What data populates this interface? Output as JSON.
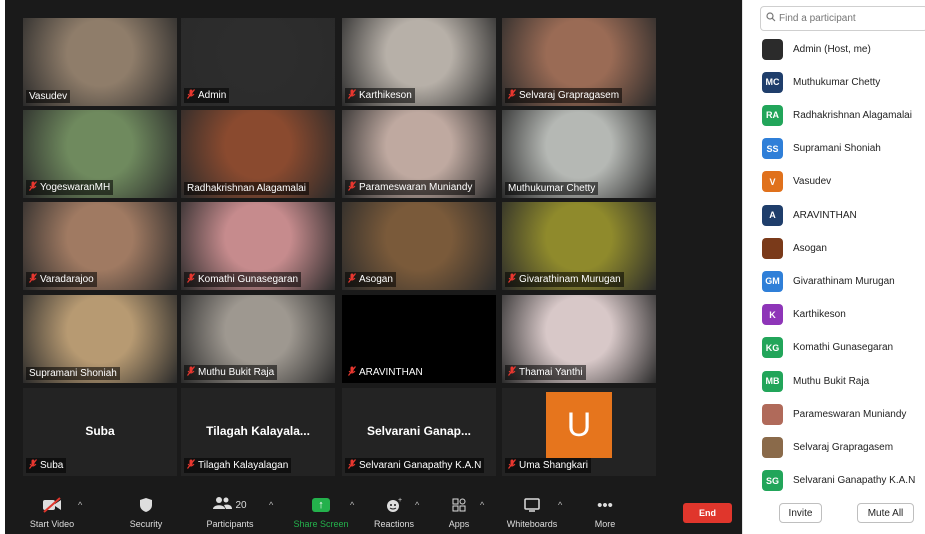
{
  "tiles": [
    {
      "name": "Vasudev",
      "muted": false,
      "video": true,
      "bg": "#8f7d6a"
    },
    {
      "name": "Admin",
      "muted": true,
      "video": true,
      "bg": "#2d2d2d"
    },
    {
      "name": "Karthikeson",
      "muted": true,
      "video": true,
      "bg": "#b7b0a8"
    },
    {
      "name": "Selvaraj Grapragasem",
      "muted": true,
      "video": true,
      "bg": "#9a6b55"
    },
    {
      "name": "YogeswaranMH",
      "muted": true,
      "video": true,
      "bg": "#6f8a5e"
    },
    {
      "name": "Radhakrishnan Alagamalai",
      "muted": false,
      "video": true,
      "bg": "#8a4a2f",
      "speaking": true
    },
    {
      "name": "Parameswaran Muniandy",
      "muted": true,
      "video": true,
      "bg": "#bfa9a0"
    },
    {
      "name": "Muthukumar Chetty",
      "muted": false,
      "video": true,
      "bg": "#b5b8b4"
    },
    {
      "name": "Varadarajoo",
      "muted": true,
      "video": true,
      "bg": "#a07a62"
    },
    {
      "name": "Komathi Gunasegaran",
      "muted": true,
      "video": true,
      "bg": "#c68b8d"
    },
    {
      "name": "Asogan",
      "muted": true,
      "video": true,
      "bg": "#7a5a3a"
    },
    {
      "name": "Givarathinam Murugan",
      "muted": true,
      "video": true,
      "bg": "#8f8a2c"
    },
    {
      "name": "Supramani Shoniah",
      "muted": false,
      "video": true,
      "bg": "#b79a72"
    },
    {
      "name": "Muthu Bukit Raja",
      "muted": true,
      "video": true,
      "bg": "#9e9890"
    },
    {
      "name": "ARAVINTHAN",
      "muted": true,
      "video": false,
      "bg": "#000000"
    },
    {
      "name": "Thamai Yanthi",
      "muted": true,
      "video": true,
      "bg": "#d8c8c8"
    },
    {
      "name": "Suba",
      "muted": true,
      "video": false,
      "big": "Suba"
    },
    {
      "name": "Tilagah Kalayalagan",
      "muted": true,
      "video": false,
      "big": "Tilagah  Kalayala..."
    },
    {
      "name": "Selvarani Ganapathy K.A.N",
      "muted": true,
      "video": false,
      "big": "Selvarani  Ganap..."
    },
    {
      "name": "Uma Shangkari",
      "muted": true,
      "video": false,
      "avatar": "U"
    }
  ],
  "toolbar": {
    "start_video": "Start Video",
    "security": "Security",
    "participants": "Participants",
    "participants_count": "20",
    "share_screen": "Share Screen",
    "reactions": "Reactions",
    "apps": "Apps",
    "whiteboards": "Whiteboards",
    "more": "More",
    "end": "End"
  },
  "panel": {
    "search_placeholder": "Find a participant",
    "participants": [
      {
        "name": "Admin (Host, me)",
        "initials": "",
        "color": "#2b2b2b"
      },
      {
        "name": "Muthukumar Chetty",
        "initials": "MC",
        "color": "#1f3e6b"
      },
      {
        "name": "Radhakrishnan Alagamalai",
        "initials": "RA",
        "color": "#22a55a"
      },
      {
        "name": "Supramani Shoniah",
        "initials": "SS",
        "color": "#2f7fd8"
      },
      {
        "name": "Vasudev",
        "initials": "V",
        "color": "#e0711c"
      },
      {
        "name": "ARAVINTHAN",
        "initials": "A",
        "color": "#1f3e6b"
      },
      {
        "name": "Asogan",
        "initials": "",
        "color": "#7a3a1a"
      },
      {
        "name": "Givarathinam Murugan",
        "initials": "GM",
        "color": "#2f7fd8"
      },
      {
        "name": "Karthikeson",
        "initials": "K",
        "color": "#8e35b8"
      },
      {
        "name": "Komathi Gunasegaran",
        "initials": "KG",
        "color": "#22a55a"
      },
      {
        "name": "Muthu Bukit Raja",
        "initials": "MB",
        "color": "#22a55a"
      },
      {
        "name": "Parameswaran Muniandy",
        "initials": "",
        "color": "#b06a5a"
      },
      {
        "name": "Selvaraj Grapragasem",
        "initials": "",
        "color": "#8a6a4a"
      },
      {
        "name": "Selvarani Ganapathy K.A.N",
        "initials": "SG",
        "color": "#22a55a"
      }
    ],
    "invite": "Invite",
    "mute_all": "Mute All"
  }
}
